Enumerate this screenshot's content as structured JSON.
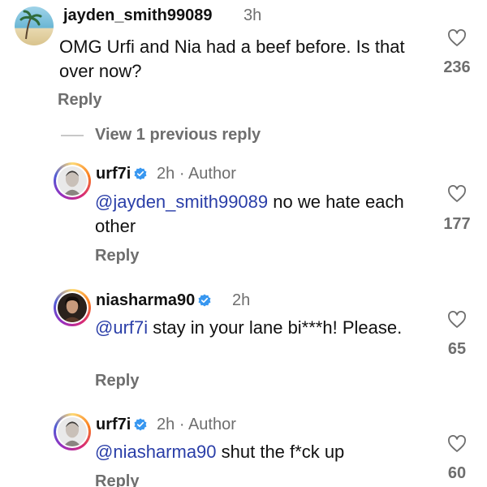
{
  "comments": [
    {
      "username": "jayden_smith99089",
      "time": "3h",
      "text": "OMG Urfi and Nia had a beef before. Is that over now?",
      "reply_label": "Reply",
      "likes": "236",
      "verified": false,
      "author_badge": ""
    },
    {
      "username": "urf7i",
      "time": "2h",
      "author_badge": "Author",
      "mention": "@jayden_smith99089",
      "text": " no we hate each other",
      "reply_label": "Reply",
      "likes": "177",
      "verified": true
    },
    {
      "username": "niasharma90",
      "time": "2h",
      "author_badge": "",
      "mention": "@urf7i",
      "text": " stay in your lane bi***h! Please.",
      "reply_label": "Reply",
      "likes": "65",
      "verified": true
    },
    {
      "username": "urf7i",
      "time": "2h",
      "author_badge": "Author",
      "mention": "@niasharma90",
      "text": " shut the f*ck up",
      "reply_label": "Reply",
      "likes": "60",
      "verified": true
    }
  ],
  "view_previous_replies": "View 1 previous reply",
  "separator": "·",
  "colors": {
    "mention": "#2a3ea8",
    "verified": "#3897f0",
    "muted": "#6e6e6e"
  },
  "icons": [
    "heart-icon",
    "verified-badge-icon",
    "avatar"
  ]
}
